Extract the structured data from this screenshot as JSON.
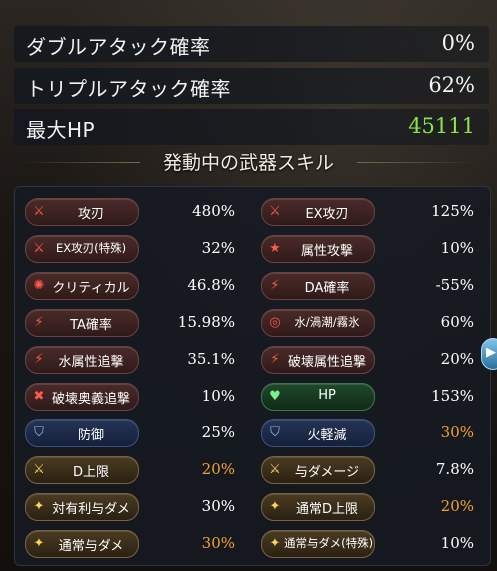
{
  "stats": [
    {
      "label": "ダブルアタック確率",
      "value": "0%",
      "highlight": false
    },
    {
      "label": "トリプルアタック確率",
      "value": "62%",
      "highlight": false
    },
    {
      "label": "最大HP",
      "value": "45111",
      "highlight": true
    }
  ],
  "skills_title": "発動中の武器スキル",
  "skills": [
    {
      "label": "攻刃",
      "value": "480%",
      "color": "red",
      "icon": "sword-icon",
      "value_orange": false
    },
    {
      "label": "EX攻刃",
      "value": "125%",
      "color": "red",
      "icon": "sword-icon",
      "value_orange": false
    },
    {
      "label": "EX攻刃(特殊)",
      "value": "32%",
      "color": "red",
      "icon": "sword-icon",
      "value_orange": false
    },
    {
      "label": "属性攻撃",
      "value": "10%",
      "color": "red",
      "icon": "star-icon",
      "value_orange": false
    },
    {
      "label": "クリティカル",
      "value": "46.8%",
      "color": "red",
      "icon": "burst-icon",
      "value_orange": false
    },
    {
      "label": "DA確率",
      "value": "-55%",
      "color": "red",
      "icon": "slash-icon",
      "value_orange": false
    },
    {
      "label": "TA確率",
      "value": "15.98%",
      "color": "red",
      "icon": "slash-icon",
      "value_orange": false
    },
    {
      "label": "水/渦潮/霧氷",
      "value": "60%",
      "color": "red",
      "icon": "swirl-icon",
      "value_orange": false
    },
    {
      "label": "水属性追撃",
      "value": "35.1%",
      "color": "red",
      "icon": "slash-icon",
      "value_orange": false
    },
    {
      "label": "破壊属性追撃",
      "value": "20%",
      "color": "red",
      "icon": "slash-icon",
      "value_orange": false
    },
    {
      "label": "破壊奥義追撃",
      "value": "10%",
      "color": "red",
      "icon": "cross-icon",
      "value_orange": false
    },
    {
      "label": "HP",
      "value": "153%",
      "color": "green",
      "icon": "heart-icon",
      "value_orange": false
    },
    {
      "label": "防御",
      "value": "25%",
      "color": "blue",
      "icon": "shield-icon",
      "value_orange": false
    },
    {
      "label": "火軽減",
      "value": "30%",
      "color": "blue",
      "icon": "shield-icon",
      "value_orange": true
    },
    {
      "label": "D上限",
      "value": "20%",
      "color": "gold",
      "icon": "sword-icon",
      "value_orange": true
    },
    {
      "label": "与ダメージ",
      "value": "7.8%",
      "color": "gold",
      "icon": "sword-icon",
      "value_orange": false
    },
    {
      "label": "対有利与ダメ",
      "value": "30%",
      "color": "gold",
      "icon": "sparkle-icon",
      "value_orange": false
    },
    {
      "label": "通常D上限",
      "value": "20%",
      "color": "gold",
      "icon": "sparkle-icon",
      "value_orange": true
    },
    {
      "label": "通常与ダメ",
      "value": "30%",
      "color": "gold",
      "icon": "sparkle-icon",
      "value_orange": true
    },
    {
      "label": "通常与ダメ(特殊)",
      "value": "10%",
      "color": "gold",
      "icon": "sparkle-icon",
      "value_orange": false
    }
  ],
  "colors": {
    "hp_green": "#8be24a",
    "orange_value": "#f3a22e",
    "red_icon": "#ff5a4a"
  }
}
